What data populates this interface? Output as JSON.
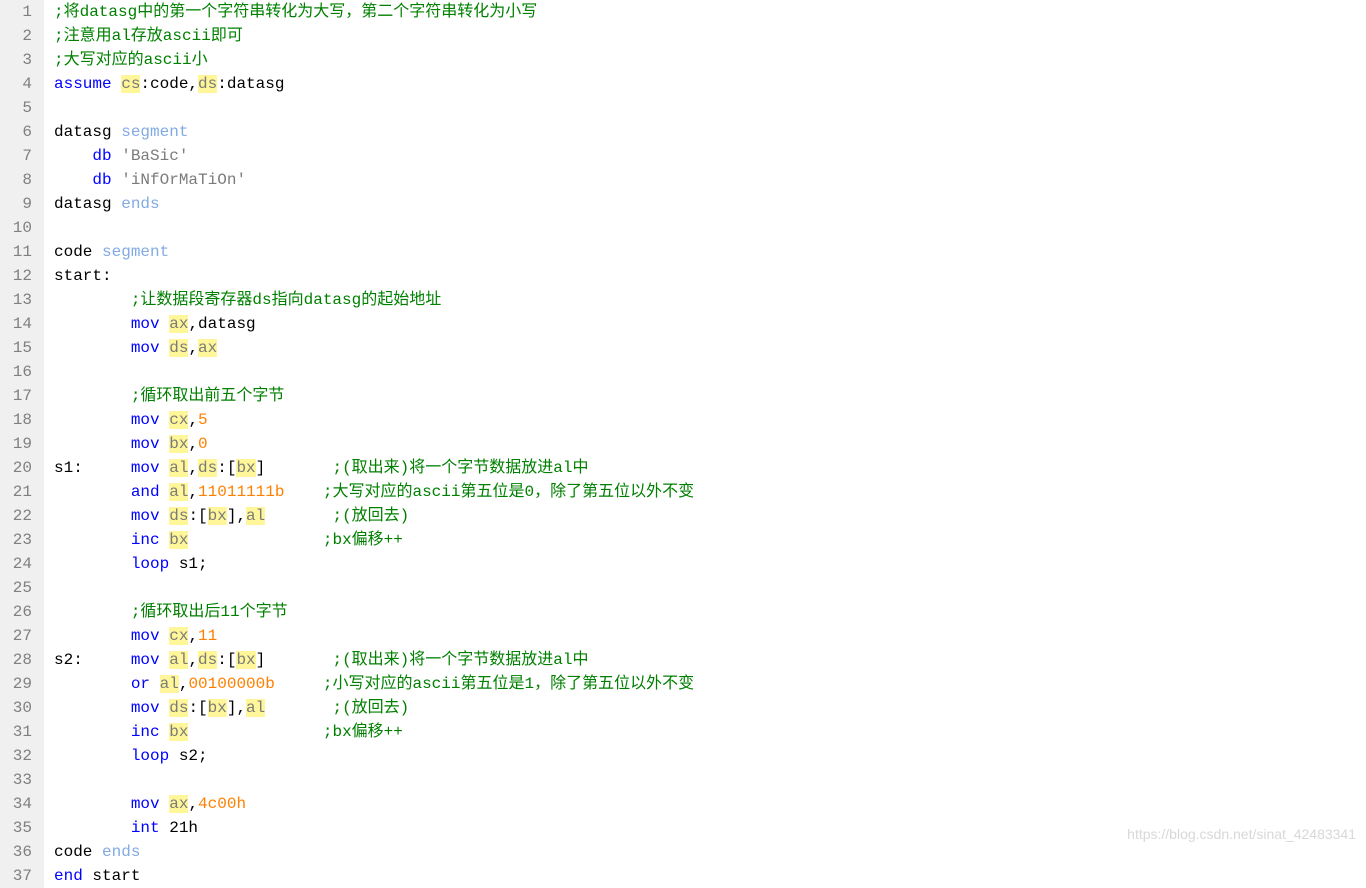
{
  "watermark": "https://blog.csdn.net/sinat_42483341",
  "lines": [
    {
      "n": 1,
      "html": "<span class='comment'>;将datasg中的第一个字符串转化为大写，第二个字符串转化为小写</span>"
    },
    {
      "n": 2,
      "html": "<span class='comment'>;注意用al存放ascii即可</span>"
    },
    {
      "n": 3,
      "html": "<span class='comment'>;大写对应的ascii小</span>"
    },
    {
      "n": 4,
      "html": "<span class='kw-blue'>assume</span> <span class='reg-gray'>cs</span>:code,<span class='reg-gray'>ds</span>:datasg"
    },
    {
      "n": 5,
      "html": ""
    },
    {
      "n": 6,
      "html": "datasg <span class='ident-blue'>segment</span>"
    },
    {
      "n": 7,
      "html": "    <span class='kw-blue'>db</span> <span class='str'>'BaSic'</span>"
    },
    {
      "n": 8,
      "html": "    <span class='kw-blue'>db</span> <span class='str'>'iNfOrMaTiOn'</span>"
    },
    {
      "n": 9,
      "html": "datasg <span class='ident-blue'>ends</span>"
    },
    {
      "n": 10,
      "html": ""
    },
    {
      "n": 11,
      "html": "code <span class='ident-blue'>segment</span>"
    },
    {
      "n": 12,
      "html": "start:"
    },
    {
      "n": 13,
      "html": "        <span class='comment'>;让数据段寄存器ds指向datasg的起始地址</span>"
    },
    {
      "n": 14,
      "html": "        <span class='kw-blue'>mov</span> <span class='reg-gray'>ax</span>,datasg"
    },
    {
      "n": 15,
      "html": "        <span class='kw-blue'>mov</span> <span class='reg-gray'>ds</span>,<span class='reg-gray'>ax</span>"
    },
    {
      "n": 16,
      "html": ""
    },
    {
      "n": 17,
      "html": "        <span class='comment'>;循环取出前五个字节</span>"
    },
    {
      "n": 18,
      "html": "        <span class='kw-blue'>mov</span> <span class='reg-gray'>cx</span>,<span class='num-orange'>5</span>"
    },
    {
      "n": 19,
      "html": "        <span class='kw-blue'>mov</span> <span class='reg-gray'>bx</span>,<span class='num-orange'>0</span>"
    },
    {
      "n": 20,
      "html": "s1:     <span class='kw-blue'>mov</span> <span class='reg-gray'>al</span>,<span class='reg-gray'>ds</span>:[<span class='reg-gray'>bx</span>]       <span class='comment'>;(取出来)将一个字节数据放进al中</span>"
    },
    {
      "n": 21,
      "html": "        <span class='kw-blue'>and</span> <span class='reg-gray'>al</span>,<span class='num-orange'>11011111b</span>    <span class='comment'>;大写对应的ascii第五位是0，除了第五位以外不变</span>"
    },
    {
      "n": 22,
      "html": "        <span class='kw-blue'>mov</span> <span class='reg-gray'>ds</span>:[<span class='reg-gray'>bx</span>],<span class='reg-gray'>al</span>       <span class='comment'>;(放回去)</span>"
    },
    {
      "n": 23,
      "html": "        <span class='kw-blue'>inc</span> <span class='reg-gray'>bx</span>              <span class='comment'>;bx偏移++</span>"
    },
    {
      "n": 24,
      "html": "        <span class='kw-blue'>loop</span> s1;"
    },
    {
      "n": 25,
      "html": ""
    },
    {
      "n": 26,
      "html": "        <span class='comment'>;循环取出后11个字节</span>"
    },
    {
      "n": 27,
      "html": "        <span class='kw-blue'>mov</span> <span class='reg-gray'>cx</span>,<span class='num-orange'>11</span>"
    },
    {
      "n": 28,
      "html": "s2:     <span class='kw-blue'>mov</span> <span class='reg-gray'>al</span>,<span class='reg-gray'>ds</span>:[<span class='reg-gray'>bx</span>]       <span class='comment'>;(取出来)将一个字节数据放进al中</span>"
    },
    {
      "n": 29,
      "html": "        <span class='kw-blue'>or</span> <span class='reg-gray'>al</span>,<span class='num-orange'>00100000b</span>     <span class='comment'>;小写对应的ascii第五位是1，除了第五位以外不变</span>"
    },
    {
      "n": 30,
      "html": "        <span class='kw-blue'>mov</span> <span class='reg-gray'>ds</span>:[<span class='reg-gray'>bx</span>],<span class='reg-gray'>al</span>       <span class='comment'>;(放回去)</span>"
    },
    {
      "n": 31,
      "html": "        <span class='kw-blue'>inc</span> <span class='reg-gray'>bx</span>              <span class='comment'>;bx偏移++</span>"
    },
    {
      "n": 32,
      "html": "        <span class='kw-blue'>loop</span> s2;"
    },
    {
      "n": 33,
      "html": ""
    },
    {
      "n": 34,
      "html": "        <span class='kw-blue'>mov</span> <span class='reg-gray'>ax</span>,<span class='num-orange'>4c00h</span>"
    },
    {
      "n": 35,
      "html": "        <span class='kw-blue'>int</span> 21h"
    },
    {
      "n": 36,
      "html": "code <span class='ident-blue'>ends</span>"
    },
    {
      "n": 37,
      "html": "<span class='kw-blue'>end</span> start"
    }
  ]
}
